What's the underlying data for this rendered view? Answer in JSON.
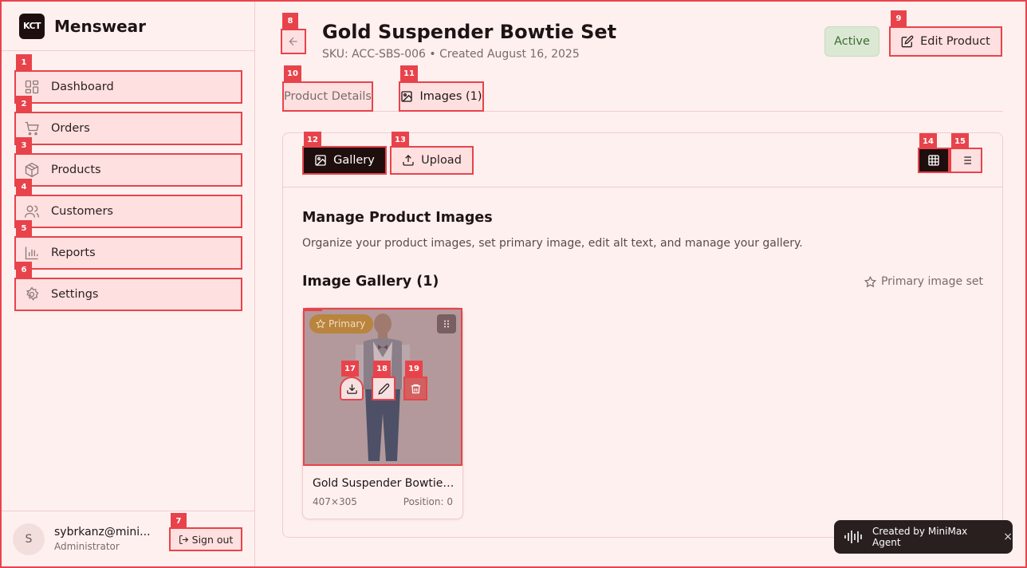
{
  "brand": {
    "logo_text": "KCT",
    "name": "Menswear"
  },
  "sidebar": {
    "items": [
      {
        "badge": "1",
        "label": "Dashboard",
        "icon": "dashboard-icon"
      },
      {
        "badge": "2",
        "label": "Orders",
        "icon": "cart-icon"
      },
      {
        "badge": "3",
        "label": "Products",
        "icon": "package-icon"
      },
      {
        "badge": "4",
        "label": "Customers",
        "icon": "users-icon"
      },
      {
        "badge": "5",
        "label": "Reports",
        "icon": "bar-chart-icon"
      },
      {
        "badge": "6",
        "label": "Settings",
        "icon": "gear-icon"
      }
    ]
  },
  "user": {
    "avatar_initial": "S",
    "email": "sybrkanz@mini...",
    "role": "Administrator",
    "signout_label": "Sign out",
    "signout_badge": "7"
  },
  "header": {
    "back_badge": "8",
    "title": "Gold Suspender Bowtie Set",
    "subtitle": "SKU: ACC-SBS-006 • Created August 16, 2025",
    "status": "Active",
    "edit_label": "Edit Product",
    "edit_badge": "9"
  },
  "tabs": [
    {
      "badge": "10",
      "label": "Product Details"
    },
    {
      "badge": "11",
      "label": "Images (1)"
    }
  ],
  "toolbar": {
    "gallery_label": "Gallery",
    "gallery_badge": "12",
    "upload_label": "Upload",
    "upload_badge": "13",
    "grid_badge": "14",
    "list_badge": "15"
  },
  "content": {
    "section_title": "Manage Product Images",
    "section_desc": "Organize your product images, set primary image, edit alt text, and manage your gallery.",
    "gallery_title": "Image Gallery (1)",
    "primary_set": "Primary image set"
  },
  "image_card": {
    "frame_badge": "16",
    "primary_tag": "Primary",
    "download_badge": "17",
    "edit_badge": "18",
    "delete_badge": "19",
    "caption": "Gold Suspender Bowtie Set",
    "dims": "407×305",
    "position": "Position: 0"
  },
  "toast": {
    "text": "Created by MiniMax Agent",
    "close": "×"
  },
  "colors": {
    "accent": "#e8434b",
    "dark": "#1f0e0e",
    "background": "#fff0f0",
    "status_green": "#3e6b30"
  }
}
